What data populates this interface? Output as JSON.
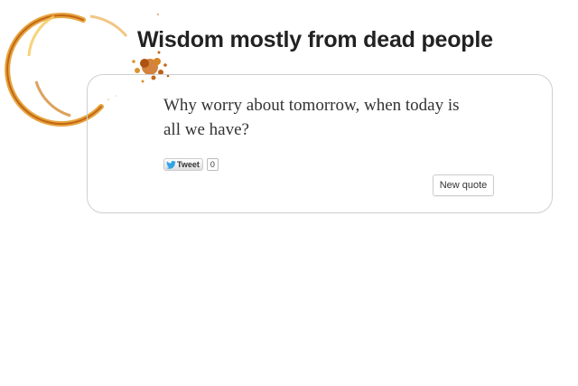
{
  "header": {
    "title": "Wisdom mostly from dead people"
  },
  "quote": {
    "text": "Why worry about tomorrow, when today is all we have?"
  },
  "share": {
    "tweet_label": "Tweet",
    "tweet_count": "0",
    "icon": "twitter-bird-icon"
  },
  "actions": {
    "new_quote_label": "New quote"
  },
  "decoration": {
    "icon": "coffee-stain-icon",
    "stain_color": "#d88a1a"
  },
  "colors": {
    "title": "#222222",
    "text": "#333333",
    "card_border": "#cfcfcf",
    "twitter_blue": "#2fa3e6"
  }
}
